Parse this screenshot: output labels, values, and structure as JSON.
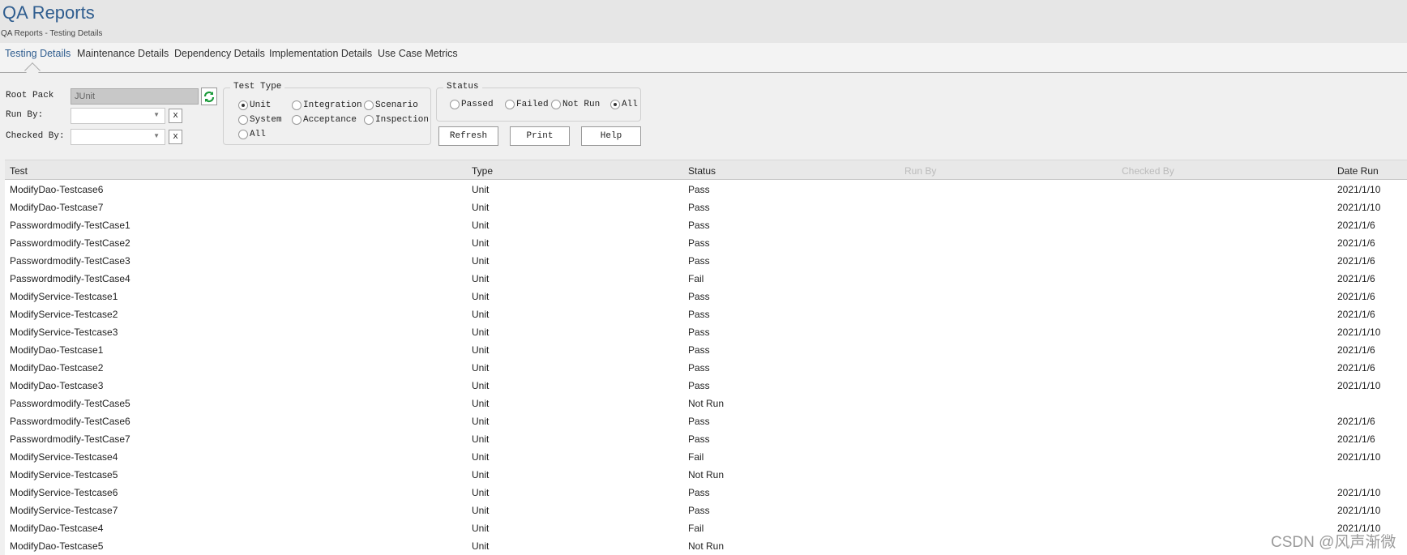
{
  "app": {
    "title": "QA Reports",
    "subtitle": "QA Reports - Testing Details"
  },
  "tabs": [
    {
      "label": "Testing Details",
      "active": true
    },
    {
      "label": "Maintenance Details"
    },
    {
      "label": "Dependency Details"
    },
    {
      "label": "Implementation Details"
    },
    {
      "label": "Use Case Metrics"
    }
  ],
  "form": {
    "root_label": "Root Pack",
    "root_value": "JUnit",
    "run_by_label": "Run By:",
    "run_by_value": "",
    "checked_by_label": "Checked By:",
    "checked_by_value": "",
    "clear_label": "x"
  },
  "test_type": {
    "legend": "Test Type",
    "options": [
      "Unit",
      "Integration",
      "Scenario",
      "System",
      "Acceptance",
      "Inspection",
      "All"
    ],
    "selected": "Unit"
  },
  "status_filter": {
    "legend": "Status",
    "options": [
      "Passed",
      "Failed",
      "Not Run",
      "All"
    ],
    "selected": "All"
  },
  "buttons": {
    "refresh": "Refresh",
    "print": "Print",
    "help": "Help"
  },
  "table": {
    "columns": [
      "Test",
      "Type",
      "Status",
      "Run By",
      "Checked By",
      "Date Run"
    ],
    "rows": [
      [
        "ModifyDao-Testcase6",
        "Unit",
        "Pass",
        "",
        "",
        "2021/1/10"
      ],
      [
        "ModifyDao-Testcase7",
        "Unit",
        "Pass",
        "",
        "",
        "2021/1/10"
      ],
      [
        "Passwordmodify-TestCase1",
        "Unit",
        "Pass",
        "",
        "",
        "2021/1/6"
      ],
      [
        "Passwordmodify-TestCase2",
        "Unit",
        "Pass",
        "",
        "",
        "2021/1/6"
      ],
      [
        "Passwordmodify-TestCase3",
        "Unit",
        "Pass",
        "",
        "",
        "2021/1/6"
      ],
      [
        "Passwordmodify-TestCase4",
        "Unit",
        "Fail",
        "",
        "",
        "2021/1/6"
      ],
      [
        "ModifyService-Testcase1",
        "Unit",
        "Pass",
        "",
        "",
        "2021/1/6"
      ],
      [
        "ModifyService-Testcase2",
        "Unit",
        "Pass",
        "",
        "",
        "2021/1/6"
      ],
      [
        "ModifyService-Testcase3",
        "Unit",
        "Pass",
        "",
        "",
        "2021/1/10"
      ],
      [
        "ModifyDao-Testcase1",
        "Unit",
        "Pass",
        "",
        "",
        "2021/1/6"
      ],
      [
        "ModifyDao-Testcase2",
        "Unit",
        "Pass",
        "",
        "",
        "2021/1/6"
      ],
      [
        "ModifyDao-Testcase3",
        "Unit",
        "Pass",
        "",
        "",
        "2021/1/10"
      ],
      [
        "Passwordmodify-TestCase5",
        "Unit",
        "Not Run",
        "",
        "",
        ""
      ],
      [
        "Passwordmodify-TestCase6",
        "Unit",
        "Pass",
        "",
        "",
        "2021/1/6"
      ],
      [
        "Passwordmodify-TestCase7",
        "Unit",
        "Pass",
        "",
        "",
        "2021/1/6"
      ],
      [
        "ModifyService-Testcase4",
        "Unit",
        "Fail",
        "",
        "",
        "2021/1/10"
      ],
      [
        "ModifyService-Testcase5",
        "Unit",
        "Not Run",
        "",
        "",
        ""
      ],
      [
        "ModifyService-Testcase6",
        "Unit",
        "Pass",
        "",
        "",
        "2021/1/10"
      ],
      [
        "ModifyService-Testcase7",
        "Unit",
        "Pass",
        "",
        "",
        "2021/1/10"
      ],
      [
        "ModifyDao-Testcase4",
        "Unit",
        "Fail",
        "",
        "",
        "2021/1/10"
      ],
      [
        "ModifyDao-Testcase5",
        "Unit",
        "Not Run",
        "",
        "",
        ""
      ]
    ]
  },
  "watermark": "CSDN @风声渐微"
}
